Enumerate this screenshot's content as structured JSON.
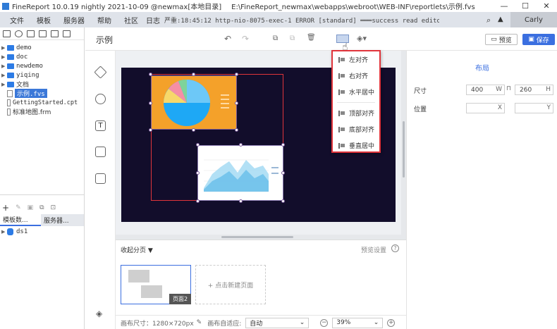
{
  "window": {
    "app_title": "FineReport 10.0.19 nightly 2021-10-09 @newmax[本地目录]",
    "file_path": "E:\\FineReport_newmax\\webapps\\webroot\\WEB-INF\\reportlets\\示例.fvs",
    "controls": [
      "—",
      "☐",
      "✕"
    ]
  },
  "menu": {
    "items": [
      "文件",
      "模板",
      "服务器",
      "帮助",
      "社区",
      "日志"
    ],
    "log_text": "严重:18:45:12 http-nio-8075-exec-1 ERROR [standard] ═══success read editor.tpl: reportle...",
    "user": "Carly"
  },
  "left_panel": {
    "tree": [
      {
        "label": "demo",
        "type": "folder"
      },
      {
        "label": "doc",
        "type": "folder"
      },
      {
        "label": "newdemo",
        "type": "folder"
      },
      {
        "label": "yiqing",
        "type": "folder"
      },
      {
        "label": "文档",
        "type": "folder"
      },
      {
        "label": "示例.fvs",
        "type": "file",
        "selected": true
      },
      {
        "label": "GettingStarted.cpt",
        "type": "file"
      },
      {
        "label": "标准地图.frm",
        "type": "file"
      }
    ],
    "tabs": [
      "模板数...",
      "服务器..."
    ],
    "datasets": [
      "ds1"
    ]
  },
  "header": {
    "title": "示例",
    "preview_label": "预览",
    "save_label": "保存"
  },
  "dropdown": {
    "items": [
      "左对齐",
      "右对齐",
      "水平居中",
      "顶部对齐",
      "底部对齐",
      "垂直居中"
    ]
  },
  "bottom": {
    "collapse_label": "收起分页 ▼",
    "preview_settings": "预览设置",
    "page_label": "页面2",
    "new_page_label": "+ 点击新建页面",
    "canvas_size_label": "画布尺寸：1280×720px",
    "canvas_adapt_label": "画布自适应:",
    "adapt_value": "自动",
    "zoom_value": "39%"
  },
  "right_panel": {
    "title": "布局",
    "size_label": "尺寸",
    "width_value": "400",
    "width_unit": "W",
    "height_value": "260",
    "height_unit": "H",
    "position_label": "位置",
    "x_unit": "X",
    "y_unit": "Y"
  },
  "colors": {
    "accent": "#3b6fe0",
    "highlight_border": "#e0343b",
    "canvas_bg": "#120d2b",
    "chart_orange": "#f4a12a"
  }
}
